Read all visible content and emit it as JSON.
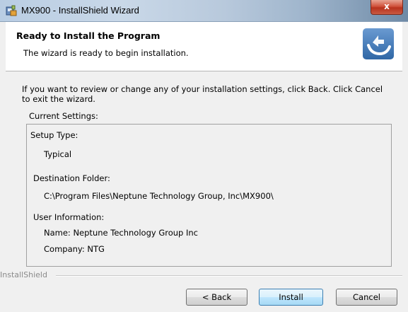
{
  "window": {
    "title": "MX900 - InstallShield Wizard",
    "close_glyph": "x"
  },
  "header": {
    "title": "Ready to Install the Program",
    "subtitle": "The wizard is ready to begin installation."
  },
  "body": {
    "instructions": "If you want to review or change any of your installation settings, click Back. Click Cancel to exit the wizard.",
    "current_settings_label": "Current Settings:",
    "settings": {
      "setup_type_label": "Setup Type:",
      "setup_type_value": "Typical",
      "destination_label": "Destination Folder:",
      "destination_value": "C:\\Program Files\\Neptune Technology Group, Inc\\MX900\\",
      "user_info_label": "User Information:",
      "user_name": "Name: Neptune Technology Group Inc",
      "user_company": "Company: NTG"
    }
  },
  "footer": {
    "brand": "InstallShield",
    "back_label": "< Back",
    "install_label": "Install",
    "cancel_label": "Cancel"
  },
  "icons": {
    "app": "installer-app-icon",
    "header": "installshield-logo-icon"
  },
  "colors": {
    "accent": "#3c7fb1",
    "close_red": "#c8432c"
  }
}
